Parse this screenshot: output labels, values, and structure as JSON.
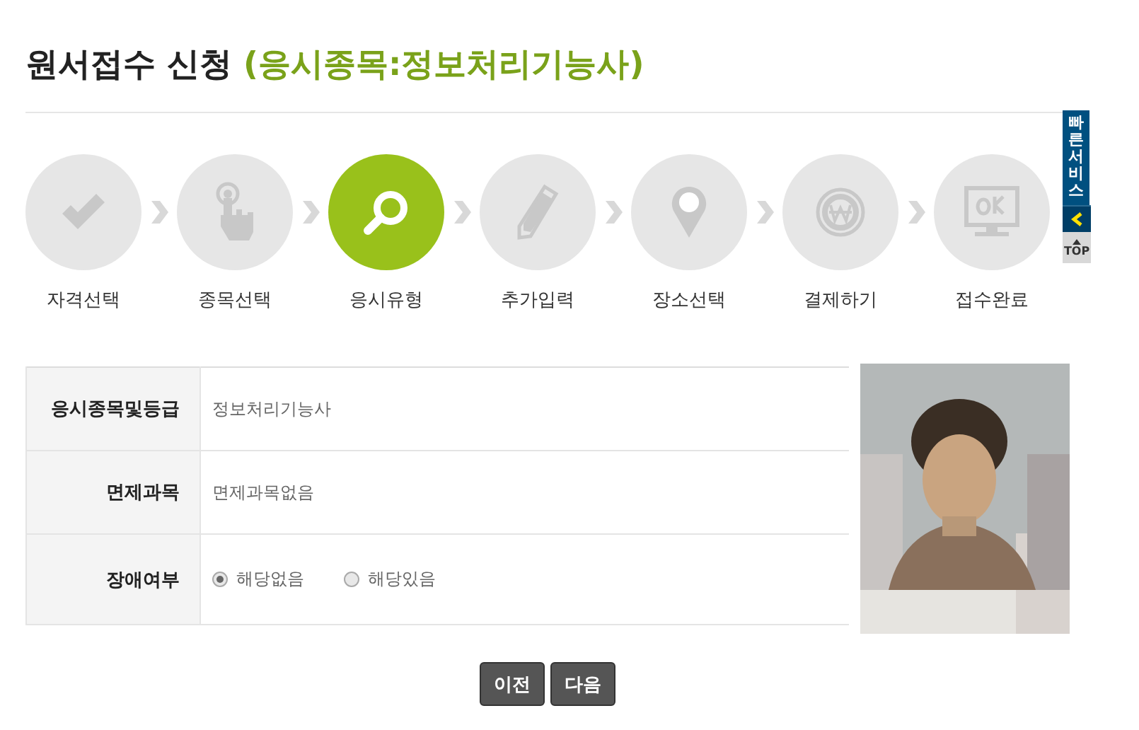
{
  "page_title": {
    "main": "원서접수 신청",
    "sub": "(응시종목:정보처리기능사)"
  },
  "steps": [
    {
      "label": "자격선택",
      "selected": false
    },
    {
      "label": "종목선택",
      "selected": false
    },
    {
      "label": "응시유형",
      "selected": true
    },
    {
      "label": "추가입력",
      "selected": false
    },
    {
      "label": "장소선택",
      "selected": false
    },
    {
      "label": "결제하기",
      "selected": false
    },
    {
      "label": "접수완료",
      "selected": false
    }
  ],
  "quick_bar": {
    "title": "빠른서비스",
    "top": "TOP"
  },
  "form": {
    "rows": [
      {
        "kind": "text",
        "label": "응시종목및등급",
        "value": "정보처리기능사"
      },
      {
        "kind": "text",
        "label": "면제과목",
        "value": "면제과목없음"
      },
      {
        "kind": "radio",
        "label": "장애여부",
        "options": [
          {
            "label": "해당없음",
            "selected": true
          },
          {
            "label": "해당있음",
            "selected": false
          }
        ]
      }
    ]
  },
  "photo": {
    "kind": "picture"
  },
  "buttons": [
    "이전",
    "다음"
  ]
}
